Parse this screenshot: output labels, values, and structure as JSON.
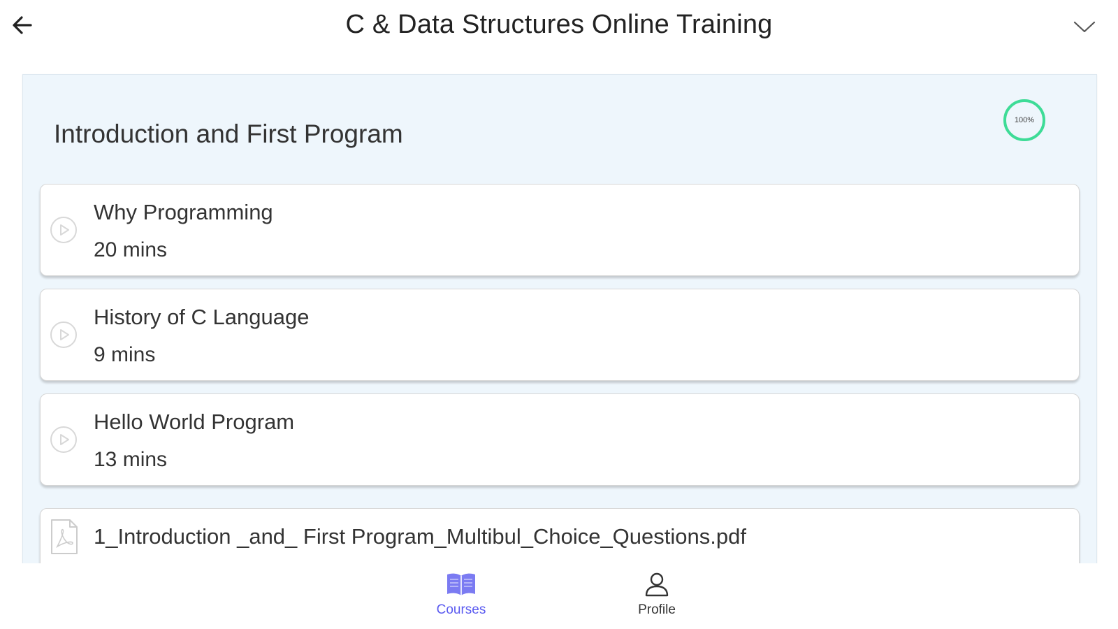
{
  "header": {
    "title": "C & Data Structures Online Training",
    "back_icon": "arrow-left-icon",
    "menu_icon": "chevron-down-icon"
  },
  "section": {
    "title": "Introduction and First Program",
    "progress_label": "100%",
    "progress_fraction": 1.0,
    "progress_color": "#3ddc97"
  },
  "lessons": [
    {
      "title": "Why Programming",
      "duration": "20 mins",
      "icon": "play-circle-icon"
    },
    {
      "title": "History of C Language",
      "duration": "9 mins",
      "icon": "play-circle-icon"
    },
    {
      "title": "Hello World Program",
      "duration": "13 mins",
      "icon": "play-circle-icon"
    }
  ],
  "attachment": {
    "name": "1_Introduction _and_ First Program_Multibul_Choice_Questions.pdf",
    "icon": "pdf-file-icon"
  },
  "bottom_nav": {
    "items": [
      {
        "label": "Courses",
        "icon": "book-icon",
        "active": true
      },
      {
        "label": "Profile",
        "icon": "person-icon",
        "active": false
      }
    ],
    "active_color": "#5b5bf0",
    "inactive_color": "#333333"
  },
  "colors": {
    "section_background": "#eef6fc",
    "card_background": "#ffffff"
  }
}
